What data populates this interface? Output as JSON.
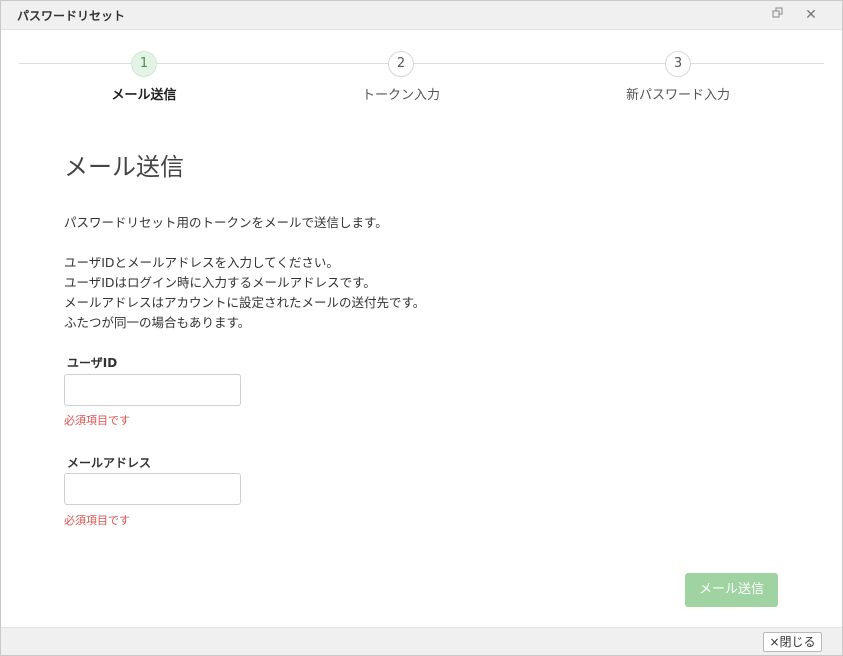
{
  "window": {
    "title": "パスワードリセット",
    "restore_icon": "restore-window-icon",
    "close_icon": "close-icon",
    "close_glyph": "✕"
  },
  "steps": [
    {
      "number": "1",
      "label": "メール送信",
      "active": true
    },
    {
      "number": "2",
      "label": "トークン入力",
      "active": false
    },
    {
      "number": "3",
      "label": "新パスワード入力",
      "active": false
    }
  ],
  "main": {
    "heading": "メール送信",
    "intro": "パスワードリセット用のトークンをメールで送信します。",
    "instructions": [
      "ユーザIDとメールアドレスを入力してください。",
      "ユーザIDはログイン時に入力するメールアドレスです。",
      "メールアドレスはアカウントに設定されたメールの送付先です。",
      "ふたつが同一の場合もあります。"
    ]
  },
  "form": {
    "user_id": {
      "label": "ユーザID",
      "value": "",
      "error": "必須項目です"
    },
    "email": {
      "label": "メールアドレス",
      "value": "",
      "error": "必須項目です"
    },
    "submit_label": "メール送信"
  },
  "footer": {
    "close_label": "×閉じる"
  },
  "colors": {
    "accent_green": "#9fd3a1",
    "active_step_bg": "#e3f3e5",
    "error_red": "#d9534f"
  }
}
